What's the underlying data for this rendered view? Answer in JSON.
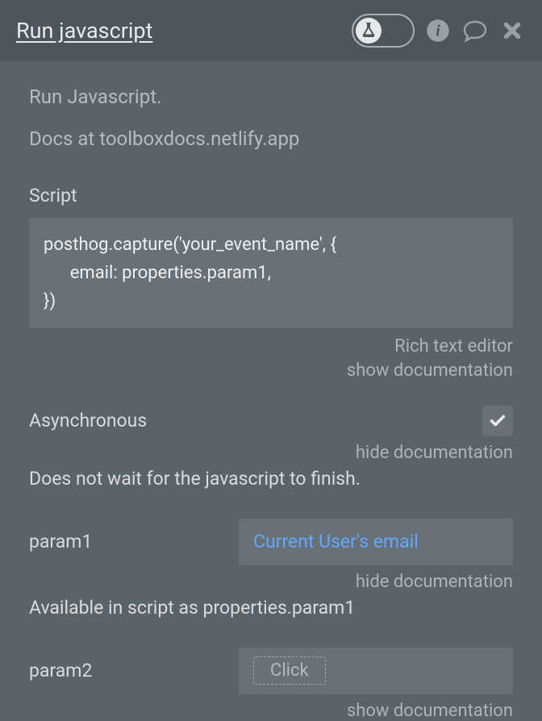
{
  "header": {
    "title": "Run javascript",
    "icons": {
      "flask": "flask-icon",
      "info": "info-icon",
      "comment": "comment-icon",
      "close": "close-icon"
    }
  },
  "desc_line1": "Run Javascript.",
  "desc_line2": "Docs at toolboxdocs.netlify.app",
  "script": {
    "label": "Script",
    "code": "posthog.capture('your_event_name', {\n      email: properties.param1,\n})",
    "link_rich": "Rich text editor",
    "link_doc": "show documentation"
  },
  "async": {
    "label": "Asynchronous",
    "checked": true,
    "doc_link": "hide documentation",
    "doc_text": "Does not wait for the javascript to finish."
  },
  "param1": {
    "label": "param1",
    "value": "Current User's email",
    "doc_link": "hide documentation",
    "doc_text": "Available in script as properties.param1"
  },
  "param2": {
    "label": "param2",
    "placeholder": "Click",
    "doc_link": "show documentation"
  }
}
